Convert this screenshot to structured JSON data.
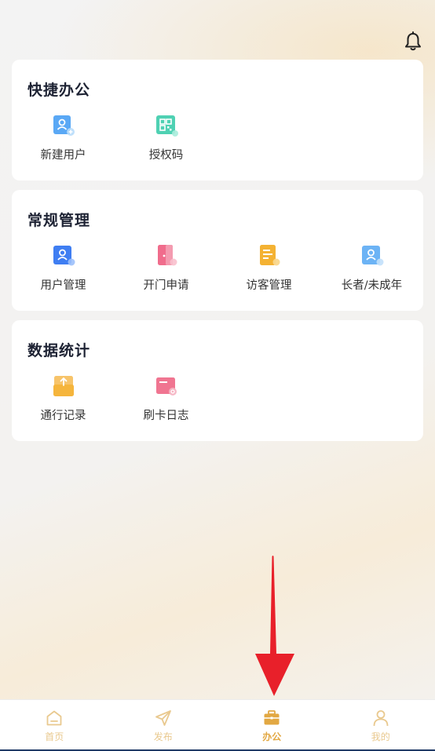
{
  "sections": [
    {
      "title": "快捷办公",
      "items": [
        {
          "label": "新建用户",
          "icon": "add-user-icon",
          "color": "#5aa8f5"
        },
        {
          "label": "授权码",
          "icon": "qr-code-icon",
          "color": "#4fd1b3"
        }
      ]
    },
    {
      "title": "常规管理",
      "items": [
        {
          "label": "用户管理",
          "icon": "user-card-icon",
          "color": "#3f7ef2"
        },
        {
          "label": "开门申请",
          "icon": "door-icon",
          "color": "#f06c8c"
        },
        {
          "label": "访客管理",
          "icon": "visitor-doc-icon",
          "color": "#f4b233"
        },
        {
          "label": "长者/未成年",
          "icon": "elder-minor-icon",
          "color": "#6cb3f5"
        }
      ]
    },
    {
      "title": "数据统计",
      "items": [
        {
          "label": "通行记录",
          "icon": "access-record-icon",
          "color": "#f5b53c"
        },
        {
          "label": "刷卡日志",
          "icon": "card-log-icon",
          "color": "#f07591"
        }
      ]
    }
  ],
  "tabbar": {
    "tabs": [
      {
        "label": "首页",
        "icon": "home-icon",
        "active": false
      },
      {
        "label": "发布",
        "icon": "send-icon",
        "active": false
      },
      {
        "label": "办公",
        "icon": "briefcase-icon",
        "active": true
      },
      {
        "label": "我的",
        "icon": "profile-icon",
        "active": false
      }
    ]
  },
  "colors": {
    "accent": "#e2a843",
    "accent_light": "#e9c98f",
    "annotation_arrow": "#e8202a"
  }
}
